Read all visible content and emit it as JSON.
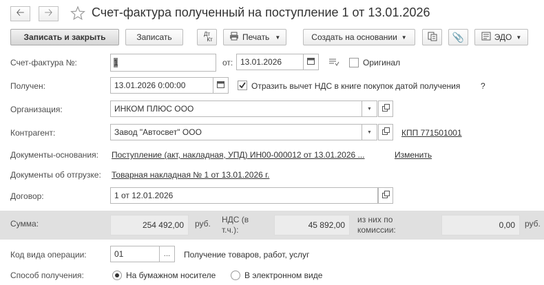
{
  "window": {
    "title": "Счет-фактура полученный на поступление 1 от 13.01.2026",
    "star_icon": "star-icon"
  },
  "toolbar": {
    "save_close": "Записать и закрыть",
    "save": "Записать",
    "dt_kt_top": "Дт",
    "dt_kt_bottom": "Кт",
    "print": "Печать",
    "create_based": "Создать на основании",
    "edo": "ЭДО"
  },
  "form": {
    "invoice_number_label": "Счет-фактура №:",
    "invoice_number_value": "1",
    "from_label": "от:",
    "from_date": "13.01.2026",
    "original_label": "Оригинал",
    "received_label": "Получен:",
    "received_datetime": "13.01.2026  0:00:00",
    "reflect_vat_label": "Отразить вычет НДС в книге покупок датой получения",
    "help_mark": "?",
    "organization_label": "Организация:",
    "organization_value": "ИНКОМ ПЛЮС ООО",
    "counterparty_label": "Контрагент:",
    "counterparty_value": "Завод \"Автосвет\" ООО",
    "kpp_link": "КПП 771501001",
    "base_docs_label": "Документы-основания:",
    "base_docs_link": "Поступление (акт, накладная, УПД) ИН00-000012 от 13.01.2026 ...",
    "change_link": "Изменить",
    "shipment_docs_label": "Документы об отгрузке:",
    "shipment_docs_link": "Товарная накладная № 1 от 13.01.2026 г.",
    "contract_label": "Договор:",
    "contract_value": "1 от 12.01.2026",
    "sum_label": "Сумма:",
    "sum_value": "254 492,00",
    "currency": "руб.",
    "vat_label_1": "НДС (в",
    "vat_label_2": "т.ч.):",
    "vat_value": "45 892,00",
    "commission_label_1": "из них по",
    "commission_label_2": "комиссии:",
    "commission_value": "0,00",
    "currency2": "руб.",
    "op_code_label": "Код вида операции:",
    "op_code_value": "01",
    "op_code_desc": "Получение товаров, работ, услуг",
    "receive_method_label": "Способ получения:",
    "receive_paper": "На бумажном носителе",
    "receive_electronic": "В электронном виде"
  },
  "state": {
    "original_checked": false,
    "reflect_vat_checked": true,
    "receive_method_selected": "paper"
  }
}
